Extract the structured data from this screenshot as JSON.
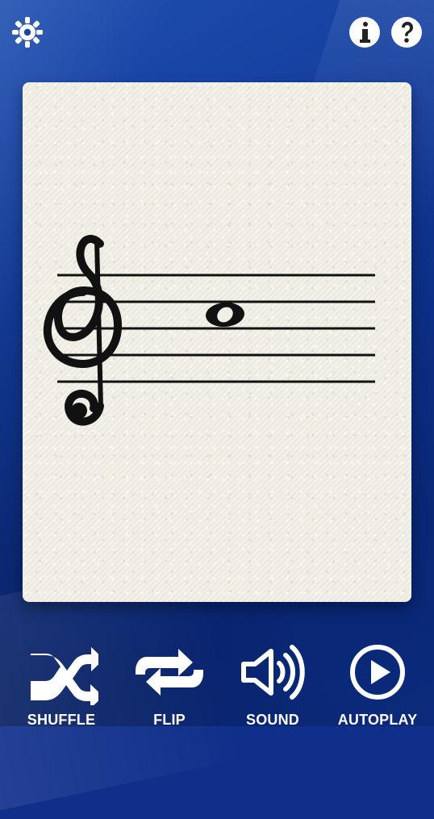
{
  "top_bar": {
    "settings_icon": "gear-icon",
    "info_icon": "info-icon",
    "help_icon": "help-icon"
  },
  "card": {
    "clef": "treble-clef",
    "note": "whole-note",
    "note_position": "third-space"
  },
  "bottom_nav": {
    "shuffle_label": "SHUFFLE",
    "flip_label": "FLIP",
    "sound_label": "SOUND",
    "autoplay_label": "AUTOPLAY"
  },
  "colors": {
    "background": "#0f2f8a",
    "card": "#f2f0e6",
    "ink": "#111111",
    "icon": "#ffffff"
  }
}
